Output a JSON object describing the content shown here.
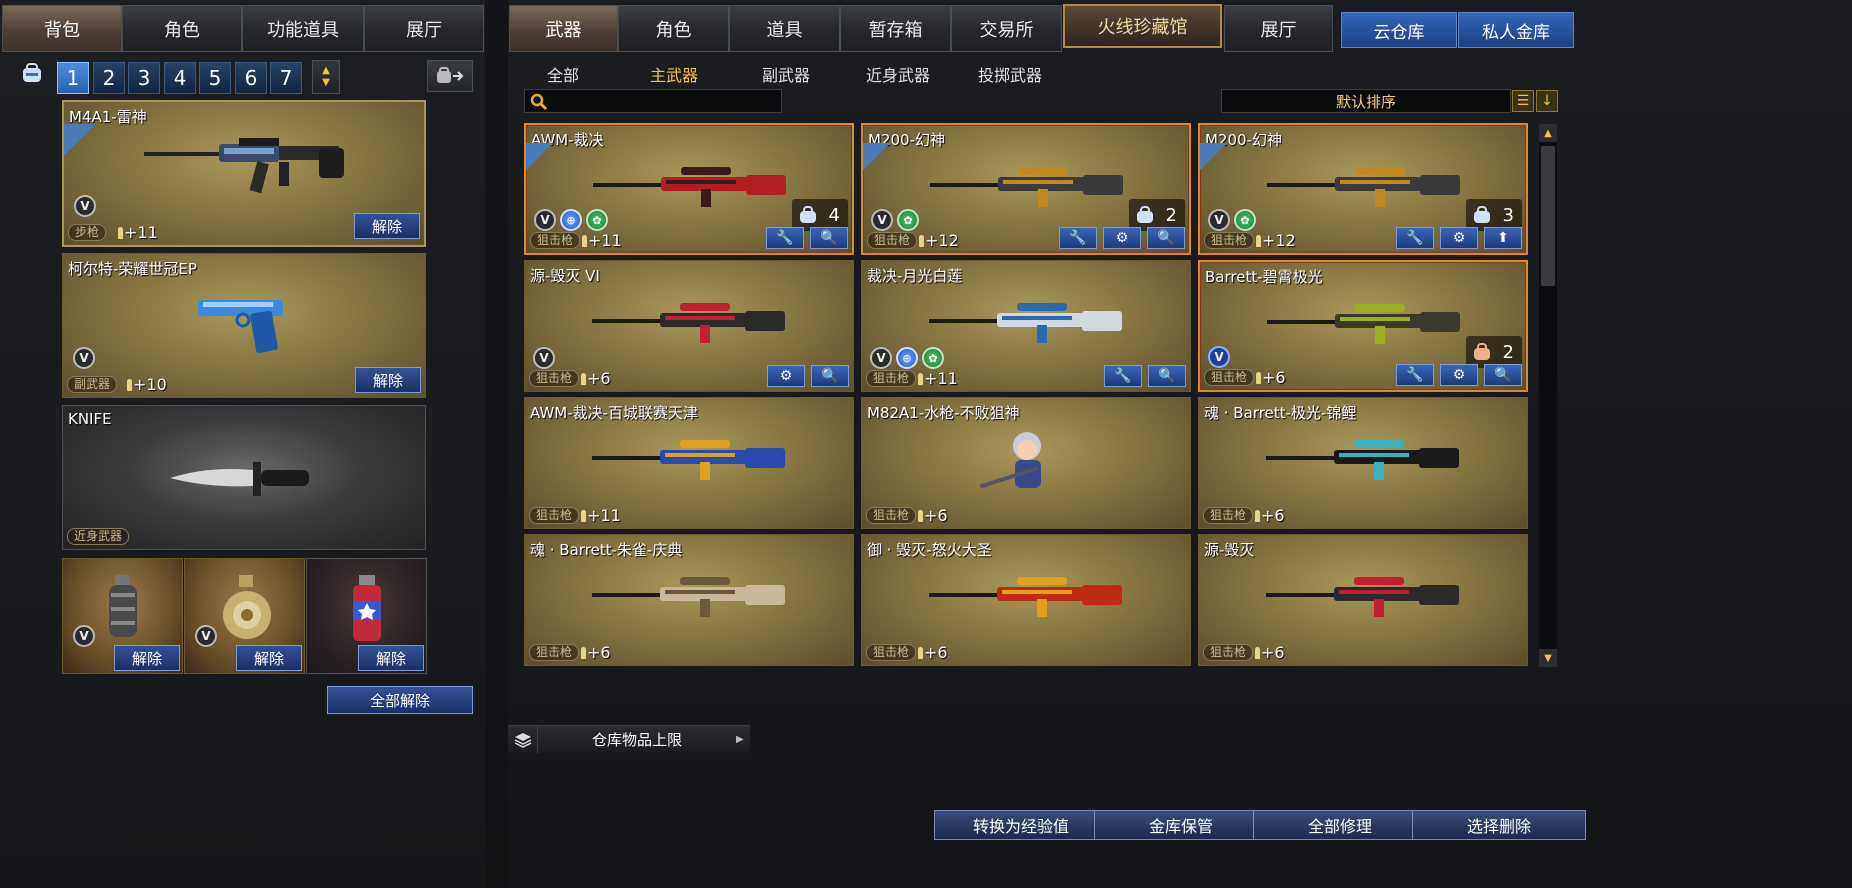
{
  "left_tabs": [
    "背包",
    "角色",
    "功能道具",
    "展厅"
  ],
  "right_tabs": [
    "武器",
    "角色",
    "道具",
    "暂存箱",
    "交易所",
    "火线珍藏馆",
    "展厅"
  ],
  "blue_tabs": [
    "云仓库",
    "私人金库"
  ],
  "pages": [
    "1",
    "2",
    "3",
    "4",
    "5",
    "6",
    "7"
  ],
  "sub_tabs": [
    "全部",
    "主武器",
    "副武器",
    "近身武器",
    "投掷武器"
  ],
  "sort_label": "默认排序",
  "search": {
    "placeholder": ""
  },
  "equipped": [
    {
      "name": "M4A1-雷神",
      "type": "步枪",
      "enhance": "+11",
      "button": "解除"
    },
    {
      "name": "柯尔特-荣耀世冠EP",
      "type": "副武器",
      "enhance": "+10",
      "button": "解除"
    },
    {
      "name": "KNIFE",
      "type": "近身武器",
      "enhance": "",
      "button": ""
    }
  ],
  "grenades": [
    {
      "button": "解除"
    },
    {
      "button": "解除"
    },
    {
      "button": "解除"
    }
  ],
  "release_all": "全部解除",
  "grid": [
    {
      "name": "AWM-裁决",
      "type": "狙击枪",
      "enhance": "+11",
      "count": "4"
    },
    {
      "name": "M200-幻神",
      "type": "狙击枪",
      "enhance": "+12",
      "count": "2"
    },
    {
      "name": "M200-幻神",
      "type": "狙击枪",
      "enhance": "+12",
      "count": "3"
    },
    {
      "name": "源-毁灭 VI",
      "type": "狙击枪",
      "enhance": "+6",
      "count": ""
    },
    {
      "name": "裁决-月光白莲",
      "type": "狙击枪",
      "enhance": "+11",
      "count": ""
    },
    {
      "name": "Barrett-碧霄极光",
      "type": "狙击枪",
      "enhance": "+6",
      "count": "2"
    },
    {
      "name": "AWM-裁决-百城联赛天津",
      "type": "狙击枪",
      "enhance": "+11",
      "count": ""
    },
    {
      "name": "M82A1-水枪-不败狙神",
      "type": "狙击枪",
      "enhance": "+6",
      "count": ""
    },
    {
      "name": "魂 · Barrett-极光-锦鲤",
      "type": "狙击枪",
      "enhance": "+6",
      "count": ""
    },
    {
      "name": "魂 · Barrett-朱雀-庆典",
      "type": "狙击枪",
      "enhance": "+6",
      "count": ""
    },
    {
      "name": "御 · 毁灭-怒火大圣",
      "type": "狙击枪",
      "enhance": "+6",
      "count": ""
    },
    {
      "name": "源-毁灭",
      "type": "狙击枪",
      "enhance": "+6",
      "count": ""
    }
  ],
  "bottom_buttons": [
    "转换为经验值",
    "金库保管",
    "全部修理",
    "选择删除"
  ],
  "storage_label": "仓库物品上限"
}
